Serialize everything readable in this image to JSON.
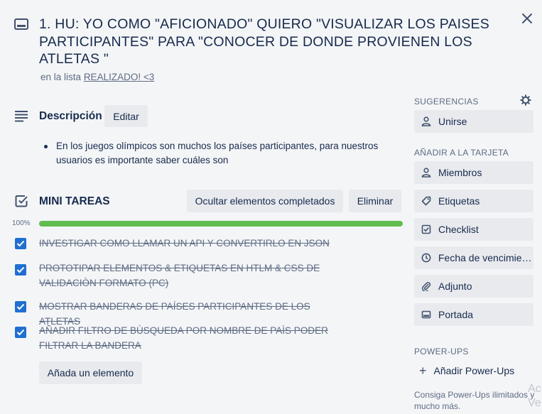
{
  "card": {
    "title": "1. HU: YO COMO \"AFICIONADO\" QUIERO \"VISUALIZAR LOS PAISES PARTICIPANTES\" PARA \"CONOCER DE DONDE PROVIENEN LOS ATLETAS \"",
    "list_prefix": "en la lista",
    "list_name": "REALIZADO! <3",
    "icon": "card-icon"
  },
  "description": {
    "heading": "Descripción",
    "edit_label": "Editar",
    "text": "En los juegos olímpicos son muchos los países participantes, para nuestros usuarios es importante saber cuáles son",
    "icon": "description-lines-icon"
  },
  "checklist": {
    "heading": "MINI TAREAS",
    "hide_label": "Ocultar elementos completados",
    "delete_label": "Eliminar",
    "progress_label": "100%",
    "progress": 1.0,
    "progress_color": "#61bd4f",
    "check_color": "#1f6fd1",
    "items": [
      {
        "text": "INVESTIGAR COMO LLAMAR UN API Y CONVERTIRLO EN JSON",
        "done": true
      },
      {
        "text": "PROTOTIPAR ELEMENTOS & ETIQUETAS EN HTLM & CSS DE VALIDACIÒN FORMATO (PC)",
        "done": true
      },
      {
        "text": "MOSTRAR BANDERAS DE PAÍSES PARTICIPANTES DE LOS ATLETAS",
        "done": true
      },
      {
        "text": "AÑADIR FILTRO DE BÙSQUEDA POR NOMBRE DE PAÌS PODER FILTRAR LA BANDERA",
        "done": true
      }
    ],
    "add_label": "Añada un elemento"
  },
  "sidebar": {
    "suggestions_heading": "SUGERENCIAS",
    "join_label": "Unirse",
    "add_heading": "AÑADIR A LA TARJETA",
    "buttons": [
      {
        "label": "Miembros",
        "icon": "person-icon"
      },
      {
        "label": "Etiquetas",
        "icon": "tag-icon"
      },
      {
        "label": "Checklist",
        "icon": "checklist-icon"
      },
      {
        "label": "Fecha de vencimiento",
        "icon": "clock-icon"
      },
      {
        "label": "Adjunto",
        "icon": "paperclip-icon"
      },
      {
        "label": "Portada",
        "icon": "cover-icon"
      }
    ],
    "powerups_heading": "POWER-UPS",
    "add_powerups_label": "Añadir Power-Ups",
    "powerups_desc": "Consiga Power-Ups ilimitados y mucho más."
  },
  "overlay": {
    "watermark_line1": "Ac",
    "watermark_line2": "Ve"
  }
}
